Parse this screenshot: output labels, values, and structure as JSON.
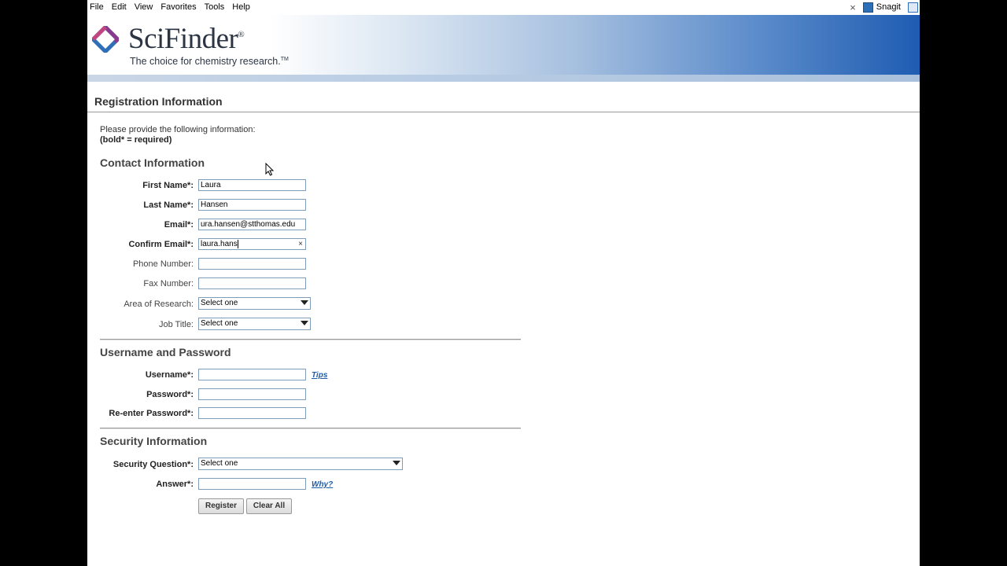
{
  "menubar": {
    "items": [
      "File",
      "Edit",
      "View",
      "Favorites",
      "Tools",
      "Help"
    ],
    "snagit_label": "Snagit"
  },
  "banner": {
    "brand": "SciFinder",
    "brand_mark": "®",
    "tagline": "The choice for chemistry research.",
    "tagline_mark": "TM"
  },
  "page": {
    "title": "Registration Information",
    "intro_line1": "Please provide the following information:",
    "intro_line2": "(bold* = required)"
  },
  "contact": {
    "heading": "Contact Information",
    "first_name_label": "First Name*:",
    "first_name_value": "Laura",
    "last_name_label": "Last Name*:",
    "last_name_value": "Hansen",
    "email_label": "Email*:",
    "email_value": "ura.hansen@stthomas.edu",
    "confirm_email_label": "Confirm Email*:",
    "confirm_email_value": "laura.hans",
    "phone_label": "Phone Number:",
    "phone_value": "",
    "fax_label": "Fax Number:",
    "fax_value": "",
    "area_label": "Area of Research:",
    "area_value": "Select one",
    "job_label": "Job Title:",
    "job_value": "Select one"
  },
  "account": {
    "heading": "Username and Password",
    "username_label": "Username*:",
    "username_value": "",
    "tips_link": "Tips",
    "password_label": "Password*:",
    "reenter_label": "Re-enter Password*:"
  },
  "security": {
    "heading": "Security Information",
    "question_label": "Security Question*:",
    "question_value": "Select one",
    "answer_label": "Answer*:",
    "answer_value": "",
    "why_link": "Why?"
  },
  "buttons": {
    "register": "Register",
    "clear_all": "Clear All"
  },
  "colors": {
    "link": "#1d5ea8",
    "banner_dark": "#1f5cb2",
    "logo_purple": "#8a3a8e",
    "logo_blue": "#2f6fb7"
  }
}
